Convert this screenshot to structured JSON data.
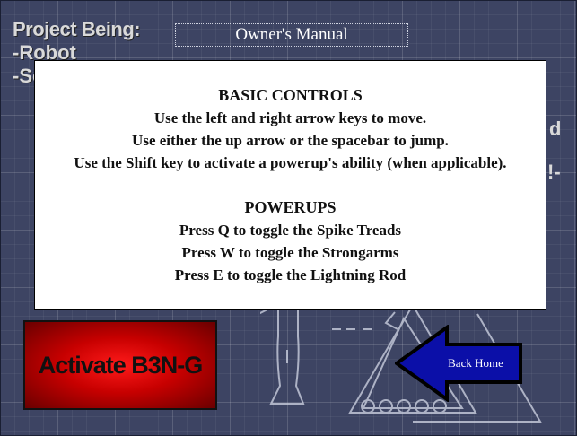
{
  "header": {
    "project_title": "Project Being:",
    "project_line_1": "-Robot",
    "project_line_2": "-Sc",
    "manual_tab": "Owner's Manual",
    "side_fragment_1": "d",
    "side_fragment_2": "!-"
  },
  "manual": {
    "basic_heading": "BASIC CONTROLS",
    "basic_lines": [
      "Use the left and right arrow keys to move.",
      "Use either the up arrow or the spacebar to jump.",
      "Use the Shift key to activate a powerup's ability (when applicable)."
    ],
    "powerups_heading": "POWERUPS",
    "powerup_lines": [
      "Press Q to toggle the Spike Treads",
      "Press W to toggle the Strongarms",
      "Press E to toggle the Lightning Rod"
    ]
  },
  "buttons": {
    "activate_label": "Activate B3N-G",
    "back_home_label": "Back Home"
  },
  "colors": {
    "background": "#3d4463",
    "activate_red": "#e00000",
    "back_arrow_blue": "#0b0fa8"
  },
  "icons": {
    "back_arrow": "left-arrow-icon"
  }
}
